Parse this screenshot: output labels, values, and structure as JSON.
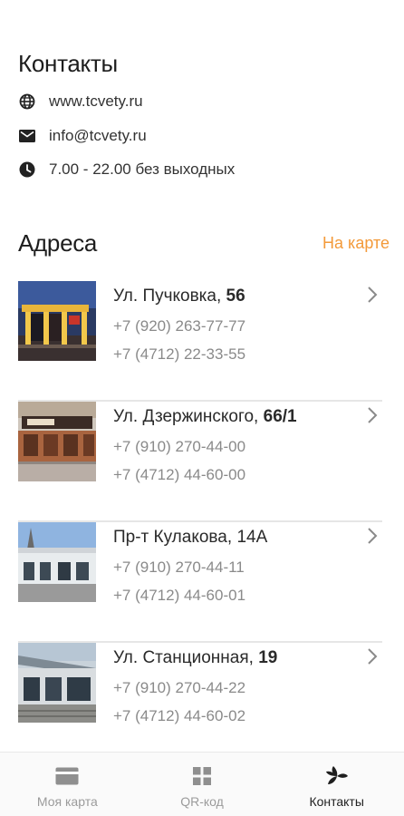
{
  "contacts": {
    "title": "Контакты",
    "website": {
      "icon": "globe-icon",
      "text": "www.tcvety.ru"
    },
    "email": {
      "icon": "mail-icon",
      "text": "info@tcvety.ru"
    },
    "hours": {
      "icon": "clock-icon",
      "text": "7.00 - 22.00 без выходных"
    }
  },
  "addresses": {
    "title": "Адреса",
    "map_link": "На карте",
    "accent_color": "#f39a3a",
    "stores": [
      {
        "street": "Ул. Пучковка, ",
        "number": "56",
        "phone1": "+7 (920) 263-77-77",
        "phone2": "+7 (4712) 22-33-55"
      },
      {
        "street": "Ул. Дзержинского, ",
        "number": "66/1",
        "phone1": "+7 (910) 270-44-00",
        "phone2": "+7 (4712) 44-60-00"
      },
      {
        "street": "Пр-т Кулакова, ",
        "number": "14А",
        "phone1": "+7 (910) 270-44-11",
        "phone2": "+7 (4712) 44-60-01"
      },
      {
        "street": "Ул. Станционная, ",
        "number": "19",
        "phone1": "+7 (910) 270-44-22",
        "phone2": "+7 (4712) 44-60-02"
      }
    ]
  },
  "nav": {
    "items": [
      {
        "label": "Моя карта",
        "icon": "card-icon",
        "active": false
      },
      {
        "label": "QR-код",
        "icon": "qr-grid-icon",
        "active": false
      },
      {
        "label": "Контакты",
        "icon": "leaf-icon",
        "active": true
      }
    ]
  }
}
